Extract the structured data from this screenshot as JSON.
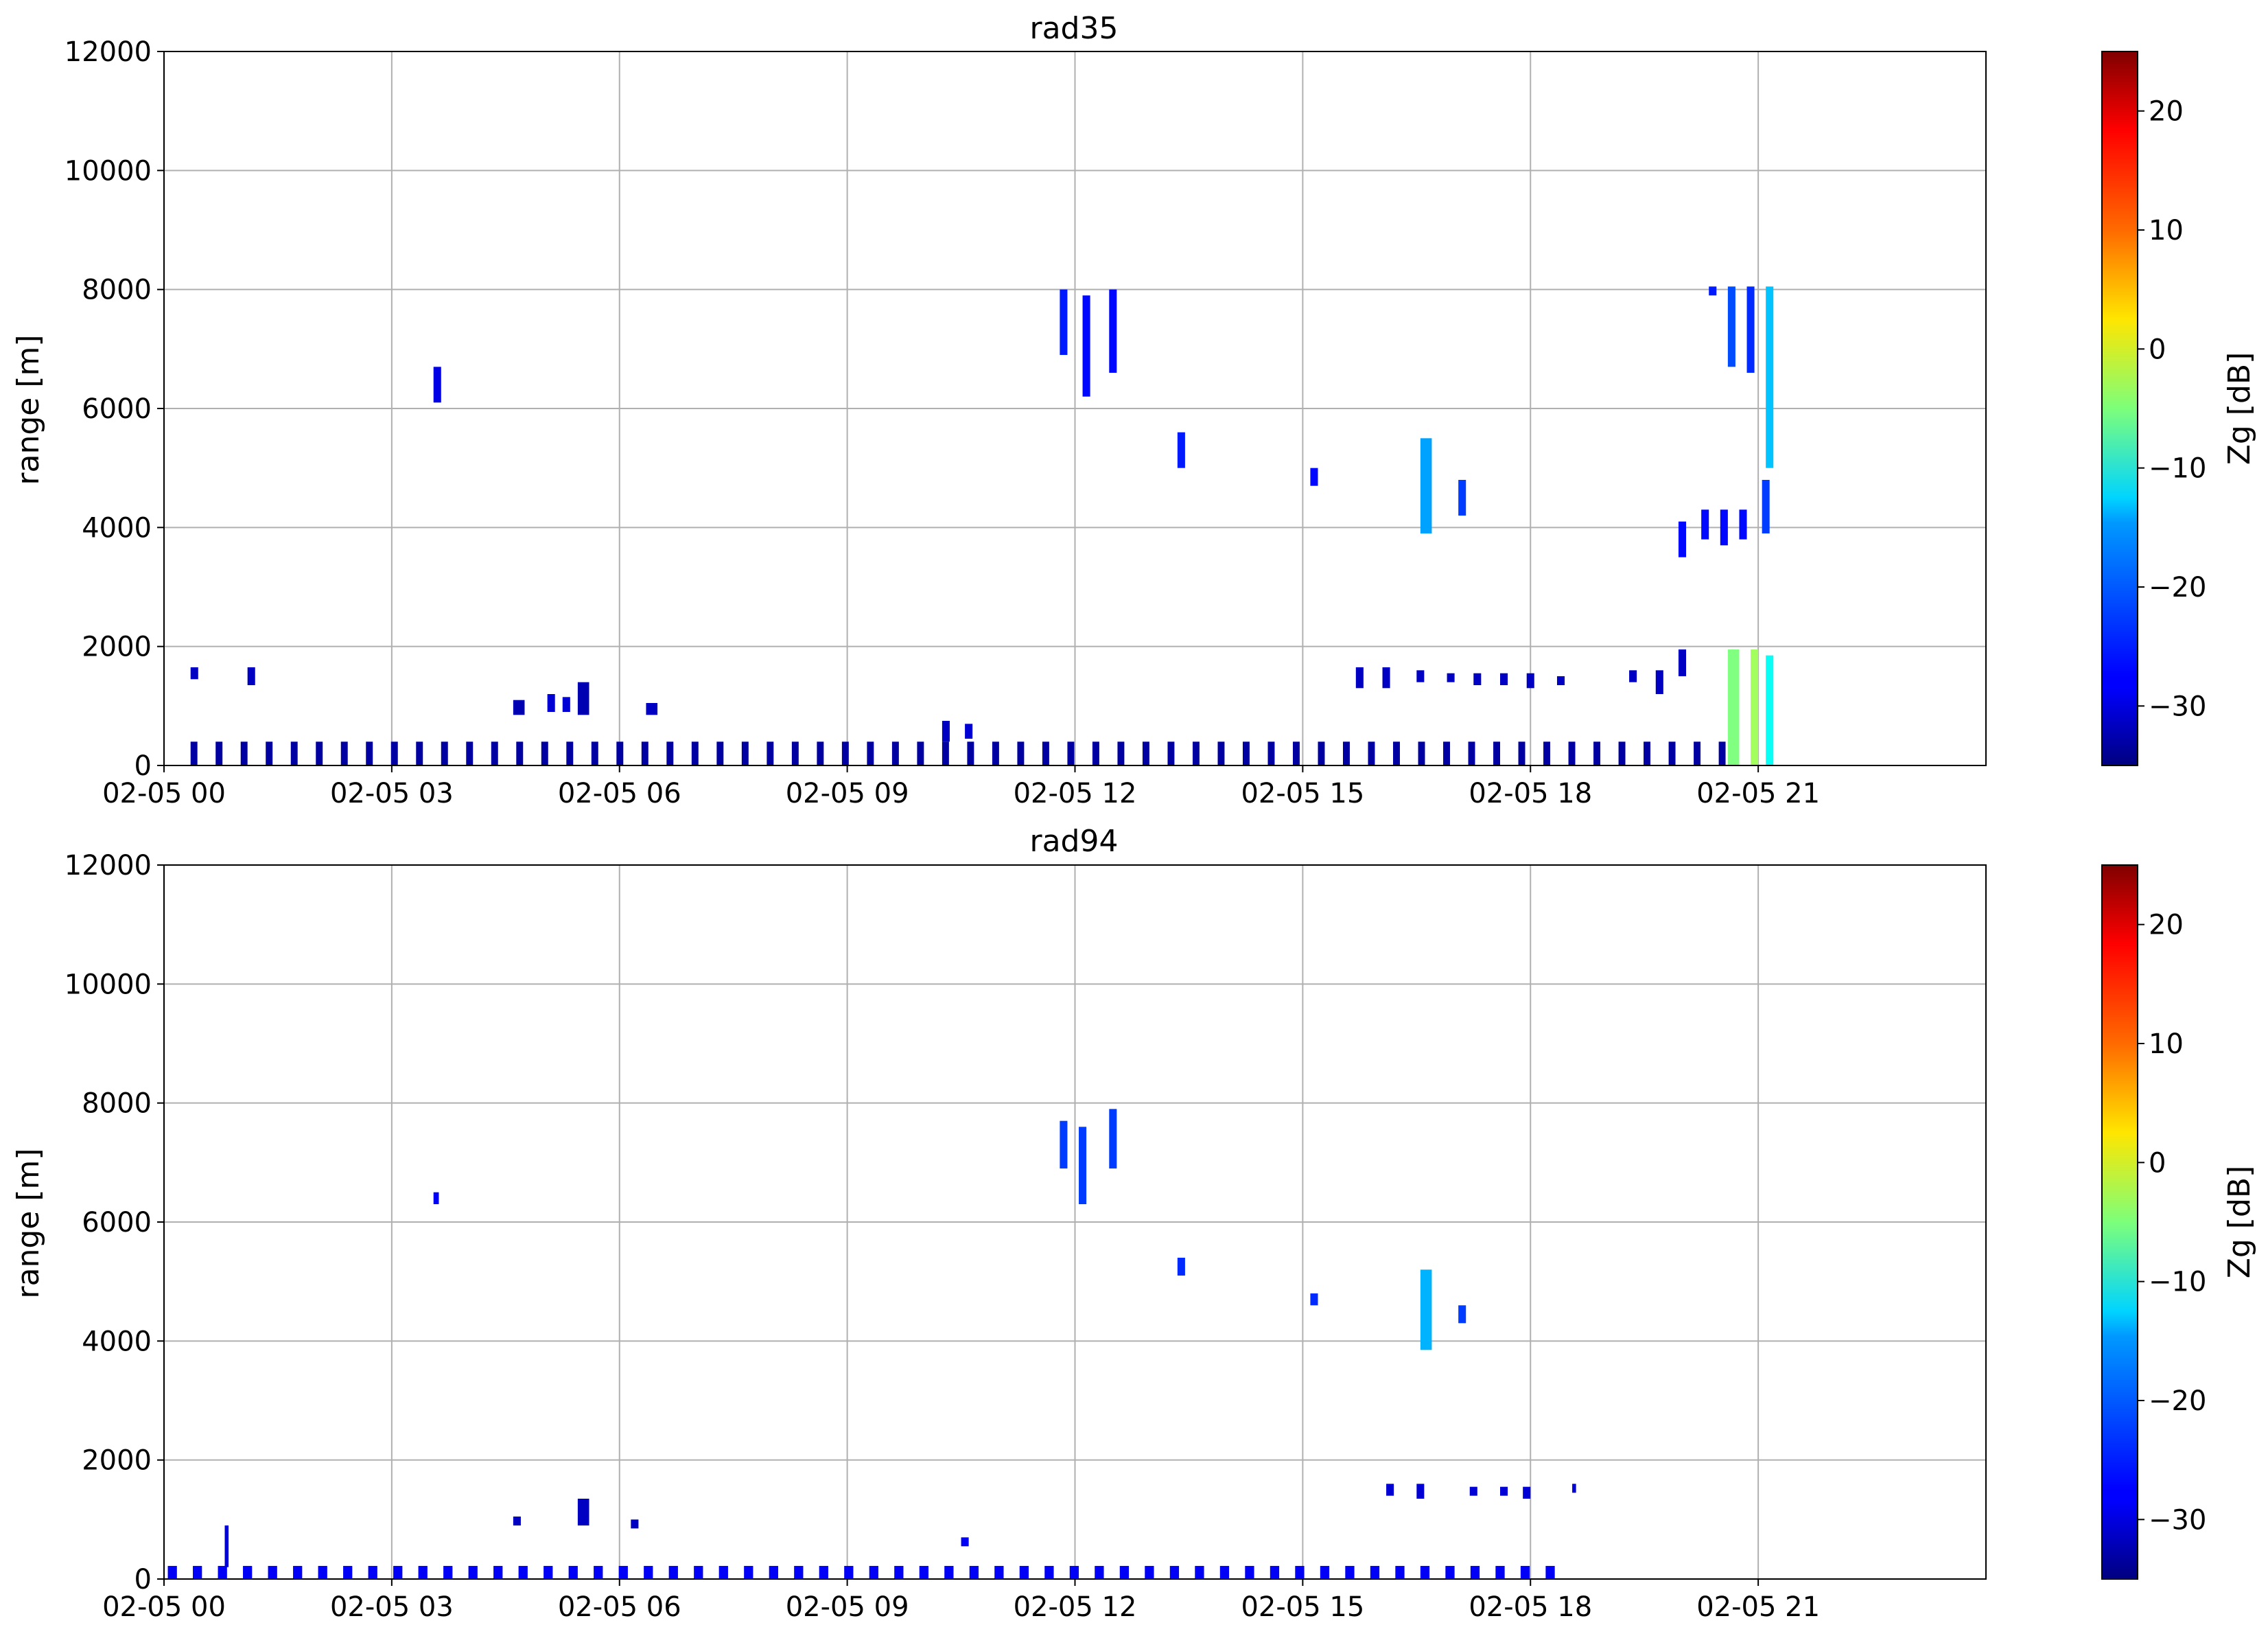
{
  "chart_data": [
    {
      "type": "heatmap",
      "title": "rad35",
      "xlabel": "",
      "ylabel": "range [m]",
      "xlim": [
        "02-05 00",
        "02-06 00"
      ],
      "ylim": [
        0,
        12000
      ],
      "x_ticks": [
        "02-05 00",
        "02-05 03",
        "02-05 06",
        "02-05 09",
        "02-05 12",
        "02-05 15",
        "02-05 18",
        "02-05 21"
      ],
      "y_ticks": [
        "0",
        "2000",
        "4000",
        "6000",
        "8000",
        "10000",
        "12000"
      ],
      "grid": true,
      "colorbar": {
        "label": "Zg [dB]",
        "range": [
          -35,
          25
        ],
        "ticks": [
          "−30",
          "−20",
          "−10",
          "0",
          "10",
          "20"
        ],
        "colormap": "jet"
      },
      "echoes": [
        {
          "kind": "periodic",
          "t_start_h": 0.35,
          "t_end_h": 20.7,
          "period_h": 0.33,
          "duration_h": 0.09,
          "r_min": 0,
          "r_max": 400,
          "z": -33
        },
        {
          "t_start_h": 0.35,
          "t_end_h": 0.45,
          "r_min": 1450,
          "r_max": 1650,
          "z": -31
        },
        {
          "t_start_h": 1.1,
          "t_end_h": 1.2,
          "r_min": 1350,
          "r_max": 1650,
          "z": -31
        },
        {
          "t_start_h": 3.55,
          "t_end_h": 3.65,
          "r_min": 6100,
          "r_max": 6700,
          "z": -29
        },
        {
          "t_start_h": 4.6,
          "t_end_h": 4.75,
          "r_min": 850,
          "r_max": 1100,
          "z": -32
        },
        {
          "t_start_h": 5.05,
          "t_end_h": 5.15,
          "r_min": 900,
          "r_max": 1200,
          "z": -30
        },
        {
          "t_start_h": 5.25,
          "t_end_h": 5.35,
          "r_min": 900,
          "r_max": 1150,
          "z": -30
        },
        {
          "t_start_h": 5.45,
          "t_end_h": 5.6,
          "r_min": 850,
          "r_max": 1400,
          "z": -32
        },
        {
          "t_start_h": 6.35,
          "t_end_h": 6.5,
          "r_min": 850,
          "r_max": 1050,
          "z": -31
        },
        {
          "t_start_h": 10.25,
          "t_end_h": 10.35,
          "r_min": 400,
          "r_max": 750,
          "z": -31
        },
        {
          "t_start_h": 10.55,
          "t_end_h": 10.65,
          "r_min": 450,
          "r_max": 700,
          "z": -30
        },
        {
          "t_start_h": 11.8,
          "t_end_h": 11.9,
          "r_min": 6900,
          "r_max": 8000,
          "z": -26
        },
        {
          "t_start_h": 12.1,
          "t_end_h": 12.2,
          "r_min": 6200,
          "r_max": 7900,
          "z": -27
        },
        {
          "t_start_h": 12.45,
          "t_end_h": 12.55,
          "r_min": 6600,
          "r_max": 8000,
          "z": -27
        },
        {
          "t_start_h": 13.35,
          "t_end_h": 13.45,
          "r_min": 5000,
          "r_max": 5600,
          "z": -26
        },
        {
          "t_start_h": 15.1,
          "t_end_h": 15.2,
          "r_min": 4700,
          "r_max": 5000,
          "z": -27
        },
        {
          "t_start_h": 16.55,
          "t_end_h": 16.7,
          "r_min": 3900,
          "r_max": 5500,
          "z": -18
        },
        {
          "t_start_h": 17.05,
          "t_end_h": 17.15,
          "r_min": 4200,
          "r_max": 4800,
          "z": -24
        },
        {
          "t_start_h": 15.7,
          "t_end_h": 15.8,
          "r_min": 1300,
          "r_max": 1650,
          "z": -31
        },
        {
          "t_start_h": 16.05,
          "t_end_h": 16.15,
          "r_min": 1300,
          "r_max": 1650,
          "z": -31
        },
        {
          "t_start_h": 16.5,
          "t_end_h": 16.6,
          "r_min": 1400,
          "r_max": 1600,
          "z": -31
        },
        {
          "t_start_h": 16.9,
          "t_end_h": 17.0,
          "r_min": 1400,
          "r_max": 1550,
          "z": -31
        },
        {
          "t_start_h": 17.25,
          "t_end_h": 17.35,
          "r_min": 1350,
          "r_max": 1550,
          "z": -31
        },
        {
          "t_start_h": 17.6,
          "t_end_h": 17.7,
          "r_min": 1350,
          "r_max": 1550,
          "z": -31
        },
        {
          "t_start_h": 17.95,
          "t_end_h": 18.05,
          "r_min": 1300,
          "r_max": 1550,
          "z": -31
        },
        {
          "t_start_h": 18.35,
          "t_end_h": 18.45,
          "r_min": 1350,
          "r_max": 1500,
          "z": -31
        },
        {
          "t_start_h": 19.3,
          "t_end_h": 19.4,
          "r_min": 1400,
          "r_max": 1600,
          "z": -31
        },
        {
          "t_start_h": 19.65,
          "t_end_h": 19.75,
          "r_min": 1200,
          "r_max": 1600,
          "z": -31
        },
        {
          "t_start_h": 19.95,
          "t_end_h": 20.05,
          "r_min": 1500,
          "r_max": 1950,
          "z": -31
        },
        {
          "t_start_h": 20.35,
          "t_end_h": 20.45,
          "r_min": 7900,
          "r_max": 8050,
          "z": -26
        },
        {
          "t_start_h": 20.6,
          "t_end_h": 20.7,
          "r_min": 6700,
          "r_max": 8050,
          "z": -23
        },
        {
          "t_start_h": 20.85,
          "t_end_h": 20.95,
          "r_min": 6600,
          "r_max": 8050,
          "z": -25
        },
        {
          "t_start_h": 21.1,
          "t_end_h": 21.2,
          "r_min": 5000,
          "r_max": 8050,
          "z": -16
        },
        {
          "t_start_h": 19.95,
          "t_end_h": 20.05,
          "r_min": 3500,
          "r_max": 4100,
          "z": -27
        },
        {
          "t_start_h": 20.25,
          "t_end_h": 20.35,
          "r_min": 3800,
          "r_max": 4300,
          "z": -27
        },
        {
          "t_start_h": 20.5,
          "t_end_h": 20.6,
          "r_min": 3700,
          "r_max": 4300,
          "z": -27
        },
        {
          "t_start_h": 20.75,
          "t_end_h": 20.85,
          "r_min": 3800,
          "r_max": 4300,
          "z": -27
        },
        {
          "t_start_h": 21.05,
          "t_end_h": 21.15,
          "r_min": 3900,
          "r_max": 4800,
          "z": -24
        },
        {
          "t_start_h": 20.6,
          "t_end_h": 20.75,
          "r_min": 0,
          "r_max": 1950,
          "z": -5
        },
        {
          "t_start_h": 20.9,
          "t_end_h": 21.0,
          "r_min": 0,
          "r_max": 1950,
          "z": -3
        },
        {
          "t_start_h": 21.1,
          "t_end_h": 21.2,
          "r_min": 0,
          "r_max": 1850,
          "z": -12
        }
      ]
    },
    {
      "type": "heatmap",
      "title": "rad94",
      "xlabel": "",
      "ylabel": "range [m]",
      "xlim": [
        "02-05 00",
        "02-06 00"
      ],
      "ylim": [
        0,
        12000
      ],
      "x_ticks": [
        "02-05 00",
        "02-05 03",
        "02-05 06",
        "02-05 09",
        "02-05 12",
        "02-05 15",
        "02-05 18",
        "02-05 21"
      ],
      "y_ticks": [
        "0",
        "2000",
        "4000",
        "6000",
        "8000",
        "10000",
        "12000"
      ],
      "grid": true,
      "colorbar": {
        "label": "Zg [dB]",
        "range": [
          -35,
          25
        ],
        "ticks": [
          "−30",
          "−20",
          "−10",
          "0",
          "10",
          "20"
        ],
        "colormap": "jet"
      },
      "echoes": [
        {
          "kind": "periodic",
          "t_start_h": 0.05,
          "t_end_h": 18.5,
          "period_h": 0.33,
          "duration_h": 0.12,
          "r_min": 0,
          "r_max": 220,
          "z": -28
        },
        {
          "t_start_h": 0.8,
          "t_end_h": 0.85,
          "r_min": 200,
          "r_max": 900,
          "z": -30
        },
        {
          "t_start_h": 3.55,
          "t_end_h": 3.62,
          "r_min": 6300,
          "r_max": 6500,
          "z": -28
        },
        {
          "t_start_h": 4.6,
          "t_end_h": 4.7,
          "r_min": 900,
          "r_max": 1050,
          "z": -31
        },
        {
          "t_start_h": 5.45,
          "t_end_h": 5.6,
          "r_min": 900,
          "r_max": 1350,
          "z": -31
        },
        {
          "t_start_h": 6.15,
          "t_end_h": 6.25,
          "r_min": 850,
          "r_max": 1000,
          "z": -31
        },
        {
          "t_start_h": 10.5,
          "t_end_h": 10.6,
          "r_min": 550,
          "r_max": 700,
          "z": -28
        },
        {
          "t_start_h": 11.8,
          "t_end_h": 11.9,
          "r_min": 6900,
          "r_max": 7700,
          "z": -24
        },
        {
          "t_start_h": 12.05,
          "t_end_h": 12.15,
          "r_min": 6300,
          "r_max": 7600,
          "z": -24
        },
        {
          "t_start_h": 12.45,
          "t_end_h": 12.55,
          "r_min": 6900,
          "r_max": 7900,
          "z": -24
        },
        {
          "t_start_h": 13.35,
          "t_end_h": 13.45,
          "r_min": 5100,
          "r_max": 5400,
          "z": -25
        },
        {
          "t_start_h": 15.1,
          "t_end_h": 15.2,
          "r_min": 4600,
          "r_max": 4800,
          "z": -25
        },
        {
          "t_start_h": 16.55,
          "t_end_h": 16.7,
          "r_min": 3850,
          "r_max": 5200,
          "z": -17
        },
        {
          "t_start_h": 17.05,
          "t_end_h": 17.15,
          "r_min": 4300,
          "r_max": 4600,
          "z": -24
        },
        {
          "t_start_h": 16.1,
          "t_end_h": 16.2,
          "r_min": 1400,
          "r_max": 1600,
          "z": -30
        },
        {
          "t_start_h": 16.5,
          "t_end_h": 16.6,
          "r_min": 1350,
          "r_max": 1600,
          "z": -30
        },
        {
          "t_start_h": 17.2,
          "t_end_h": 17.3,
          "r_min": 1400,
          "r_max": 1550,
          "z": -30
        },
        {
          "t_start_h": 17.6,
          "t_end_h": 17.7,
          "r_min": 1400,
          "r_max": 1550,
          "z": -30
        },
        {
          "t_start_h": 17.9,
          "t_end_h": 18.0,
          "r_min": 1350,
          "r_max": 1550,
          "z": -30
        },
        {
          "t_start_h": 18.55,
          "t_end_h": 18.6,
          "r_min": 1450,
          "r_max": 1600,
          "z": -30
        }
      ]
    }
  ]
}
